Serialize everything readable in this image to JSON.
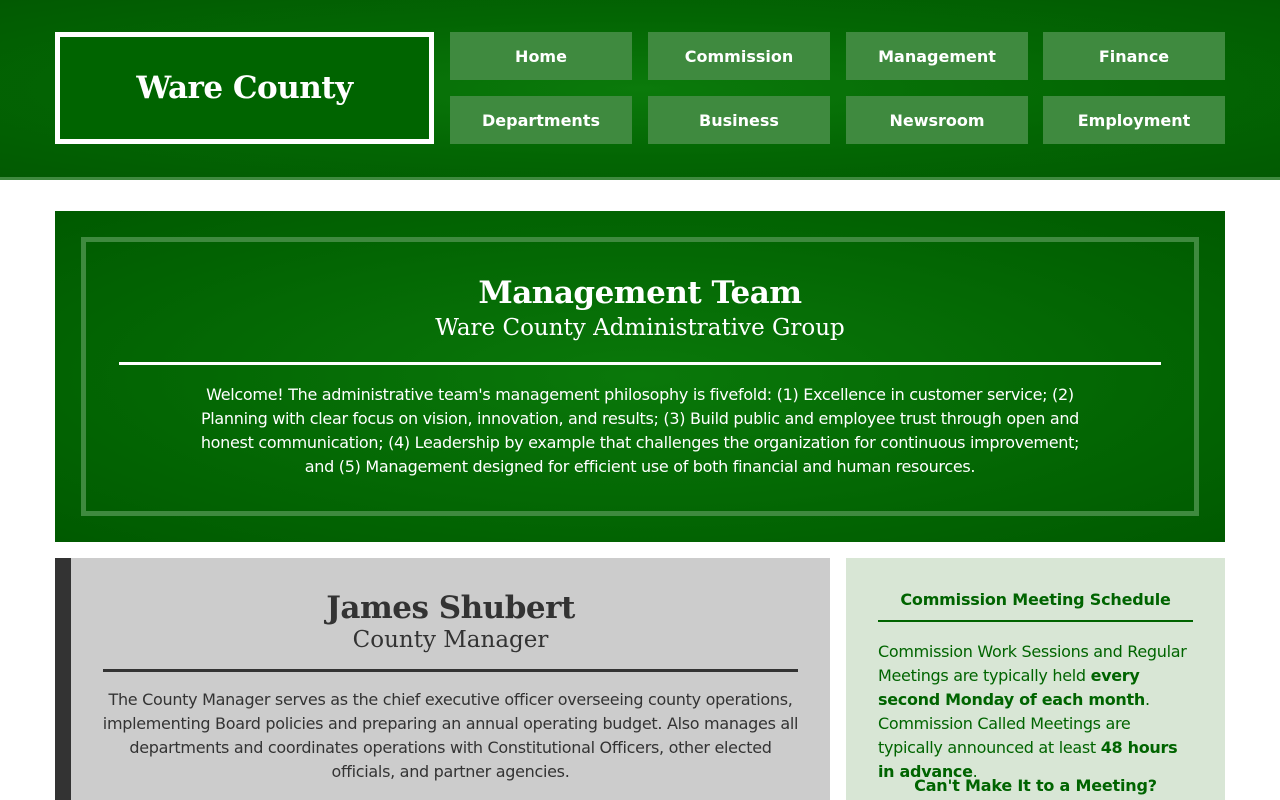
{
  "header": {
    "site_title": "Ware County",
    "nav": [
      {
        "label": "Home"
      },
      {
        "label": "Commission"
      },
      {
        "label": "Management"
      },
      {
        "label": "Finance"
      },
      {
        "label": "Departments"
      },
      {
        "label": "Business"
      },
      {
        "label": "Newsroom"
      },
      {
        "label": "Employment"
      }
    ]
  },
  "hero": {
    "title": "Management Team",
    "subtitle": "Ware County Administrative Group",
    "body": "Welcome! The administrative team's management philosophy is fivefold: (1) Excellence in customer service; (2) Planning with clear focus on vision, innovation, and results; (3) Build public and employee trust through open and honest communication; (4) Leadership by example that challenges the organization for continuous improvement; and (5) Management designed for efficient use of both financial and human resources."
  },
  "person": {
    "name": "James Shubert",
    "role": "County Manager",
    "bio": "The County Manager serves as the chief executive officer overseeing county operations, implementing Board policies and preparing an annual operating budget. Also manages all departments and coordinates operations with Constitutional Officers, other elected officials, and partner agencies."
  },
  "sidebar": {
    "title": "Commission Meeting Schedule",
    "text_1": "Commission Work Sessions and Regular Meetings are typically held ",
    "bold_1": "every second Monday of each month",
    "text_2": ". Commission Called Meetings are typically announced at least ",
    "bold_2": "48 hours in advance",
    "text_3": ".",
    "subheading": "Can't Make It to a Meeting?"
  },
  "colors": {
    "brand_green": "#006400",
    "nav_button": "#3f8a3f",
    "card_gray": "#cccccc",
    "sidebar_bg": "#d8e6d5",
    "dark": "#333333"
  }
}
